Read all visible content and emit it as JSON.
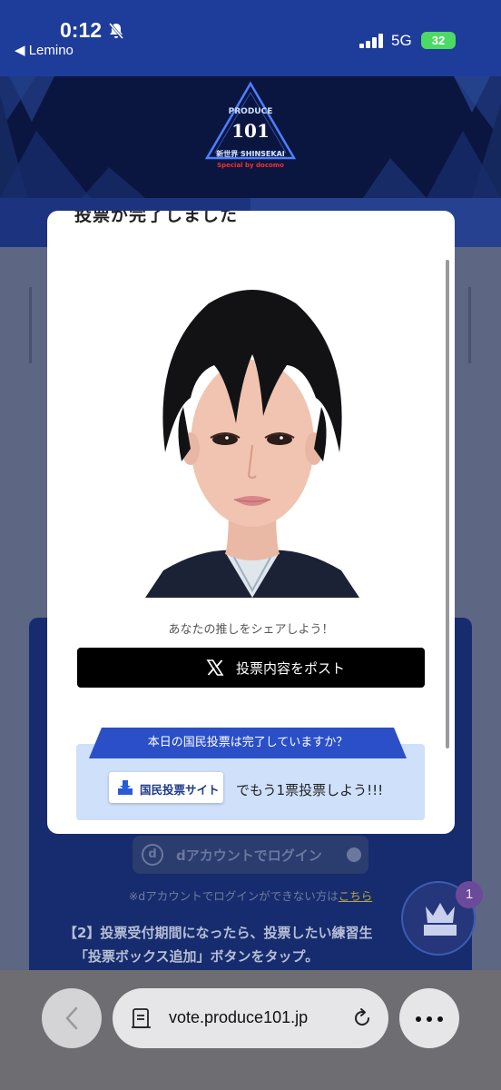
{
  "status_bar": {
    "time": "0:12",
    "back_app": "◀ Lemino",
    "network": "5G",
    "battery": "32"
  },
  "banner": {
    "logo_small": "PRODUCE",
    "logo_number": "101",
    "logo_subtitle": "新世界 SHINSEKAI",
    "logo_sponsor": "Special by docomo"
  },
  "modal": {
    "cut_title": "投票が完了しました",
    "share_prompt": "あなたの推しをシェアしよう！",
    "post_button_label": "投票内容をポスト",
    "promo_ribbon": "本日の国民投票は完了していますか？",
    "site_badge_label": "国民投票サイト",
    "promo_text": "でもう1票投票しよう!!!"
  },
  "background_page": {
    "dlogin_button": "dアカウントでログイン",
    "note_prefix": "※dアカウントでログインができない方は",
    "note_link": "こちら",
    "step_line1": "【2】投票受付期間になったら、投票したい練習生",
    "step_line2": "「投票ボックス追加」ボタンをタップ。"
  },
  "fab": {
    "badge_count": "1"
  },
  "browser": {
    "url": "vote.produce101.jp"
  },
  "colors": {
    "status_bar_bg": "#1e3c9a",
    "modal_bg": "#ffffff",
    "post_button_bg": "#000000",
    "promo_ribbon_bg": "#2a4fc7",
    "promo_box_bg": "#cfe0fb"
  }
}
